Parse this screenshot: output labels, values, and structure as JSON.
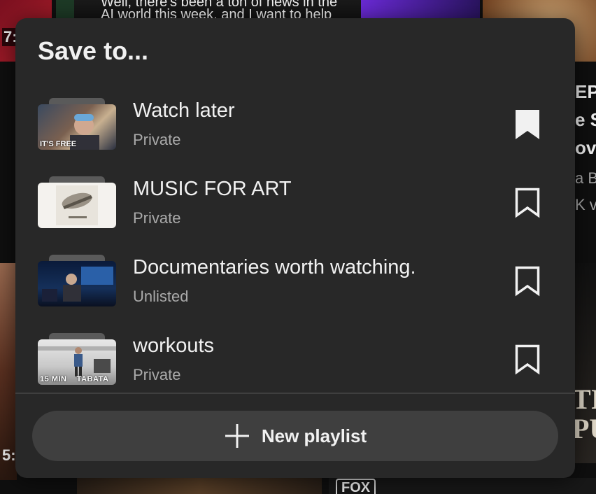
{
  "dialog": {
    "title": "Save to...",
    "playlists": [
      {
        "name": "Watch later",
        "privacy": "Private",
        "saved": true,
        "thumb_caption": "IT'S FREE"
      },
      {
        "name": "MUSIC FOR ART",
        "privacy": "Private",
        "saved": false,
        "thumb_caption": ""
      },
      {
        "name": "Documentaries worth watching.",
        "privacy": "Unlisted",
        "saved": false,
        "thumb_caption": ""
      },
      {
        "name": "workouts",
        "privacy": "Private",
        "saved": false,
        "thumb_caption": "15 MIN    TABATA"
      }
    ],
    "new_playlist_label": "New playlist",
    "icons": {
      "saved": "bookmark-filled-icon",
      "unsaved": "bookmark-outline-icon",
      "add": "plus-icon"
    }
  },
  "background": {
    "top_caption_line1": "Well, there's been a ton of news in the",
    "top_caption_line2": "AI world this week, and I want to help",
    "duration_left_top": "7:",
    "duration_left_bottom": "5:",
    "right_fragments": [
      "EP",
      "e S",
      "ov",
      "a B",
      "K v"
    ],
    "right_bottom_fragment": "TI\nPU",
    "channel_logo_text": "FOX"
  },
  "colors": {
    "dialog_bg": "#282828",
    "text_primary": "#f1f1f1",
    "text_secondary": "#aaaaaa",
    "button_bg": "#3f3f3f"
  }
}
